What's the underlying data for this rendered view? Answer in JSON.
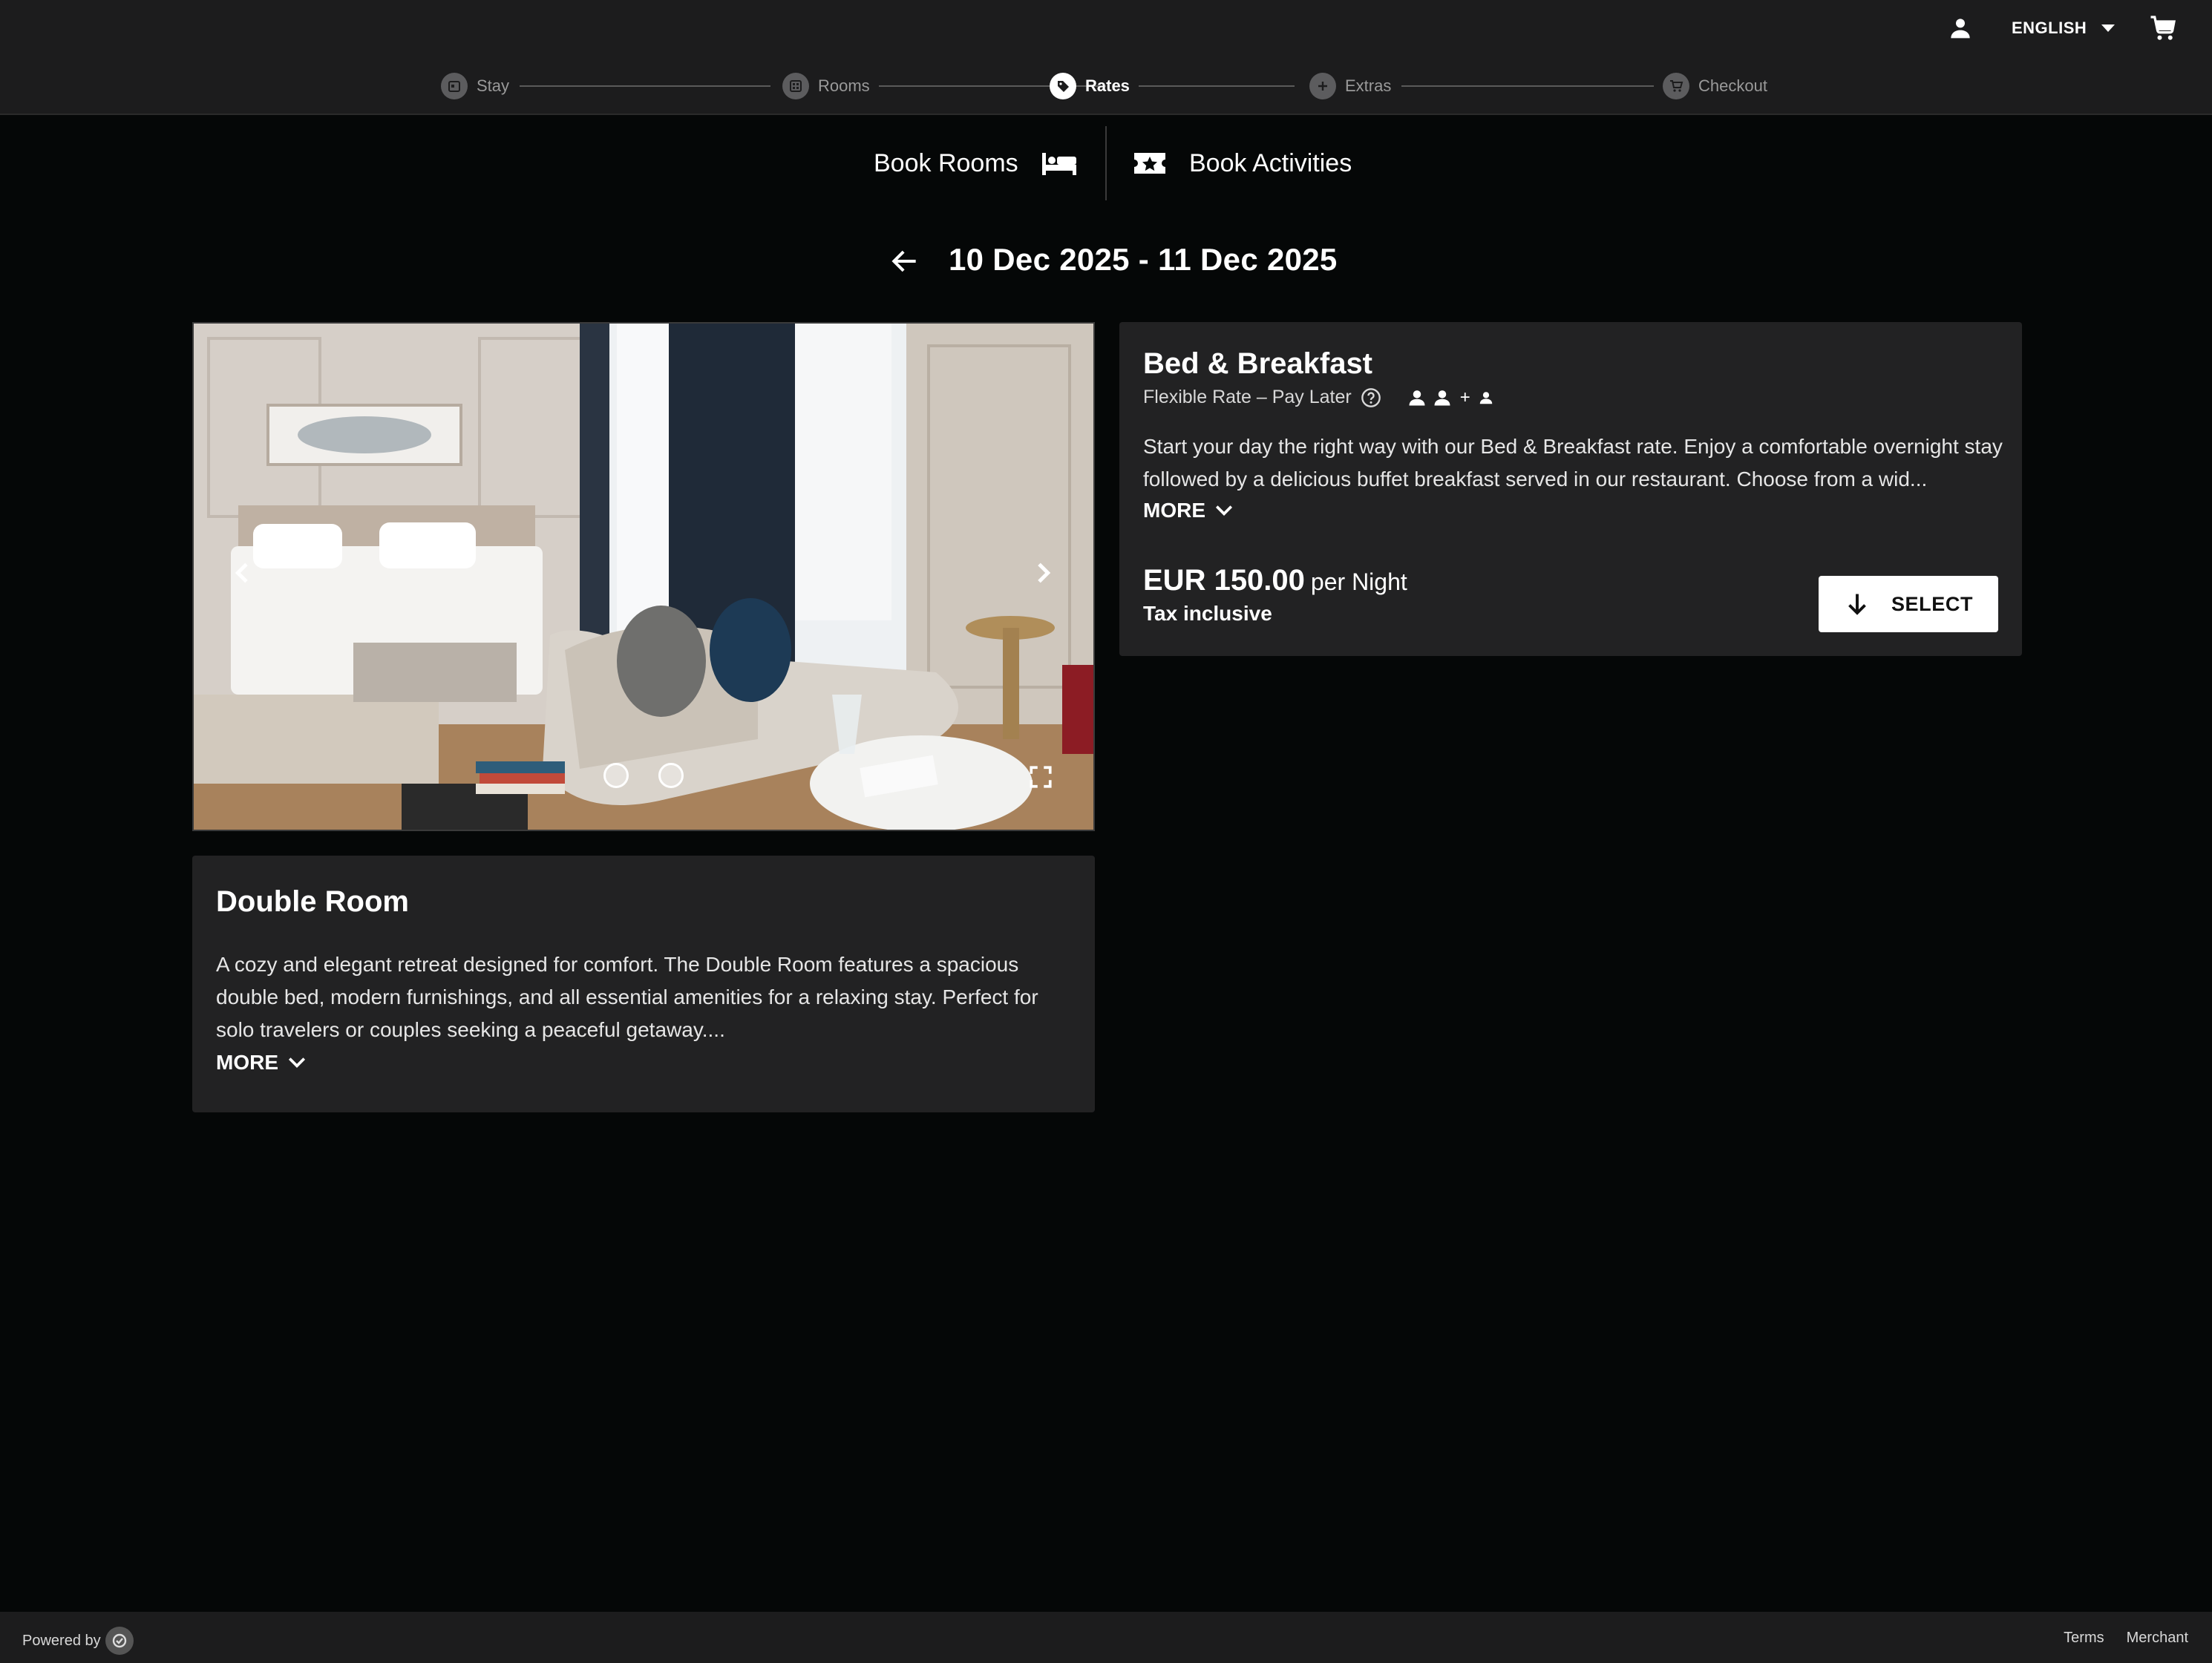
{
  "header": {
    "language": "ENGLISH",
    "steps": [
      {
        "label": "Stay",
        "icon": "calendar-icon",
        "active": false
      },
      {
        "label": "Rooms",
        "icon": "grid-icon",
        "active": false
      },
      {
        "label": "Rates",
        "icon": "tag-icon",
        "active": true
      },
      {
        "label": "Extras",
        "icon": "plus-icon",
        "active": false
      },
      {
        "label": "Checkout",
        "icon": "cart-icon",
        "active": false
      }
    ]
  },
  "booking_tabs": {
    "rooms_label": "Book Rooms",
    "activities_label": "Book Activities"
  },
  "stay": {
    "date_range": "10 Dec 2025 - 11 Dec 2025"
  },
  "room": {
    "title": "Double Room",
    "description": "A cozy and elegant retreat designed for comfort. The Double Room features a spacious double bed, modern furnishings, and all essential amenities for a relaxing stay. Perfect for solo travelers or couples seeking a peaceful getaway....",
    "more_label": "MORE",
    "image_count": 2,
    "current_image": 1
  },
  "rate": {
    "title": "Bed & Breakfast",
    "subtitle": "Flexible Rate – Pay Later",
    "occupancy": {
      "adults": 2,
      "children": 1,
      "plus": "+"
    },
    "description": "Start your day the right way with our Bed & Breakfast rate. Enjoy a comfortable overnight stay followed by a delicious buffet breakfast served in our restaurant. Choose from a wid...",
    "more_label": "MORE",
    "price": "EUR 150.00",
    "price_unit": "per Night",
    "tax_note": "Tax inclusive",
    "select_label": "SELECT"
  },
  "footer": {
    "powered_by": "Powered by",
    "links": [
      "Terms",
      "Merchant"
    ]
  },
  "colors": {
    "background": "#050707",
    "topbar": "#1c1c1d",
    "card": "#222223",
    "accent": "#ffffff",
    "step_inactive": "#5c5c5e"
  }
}
